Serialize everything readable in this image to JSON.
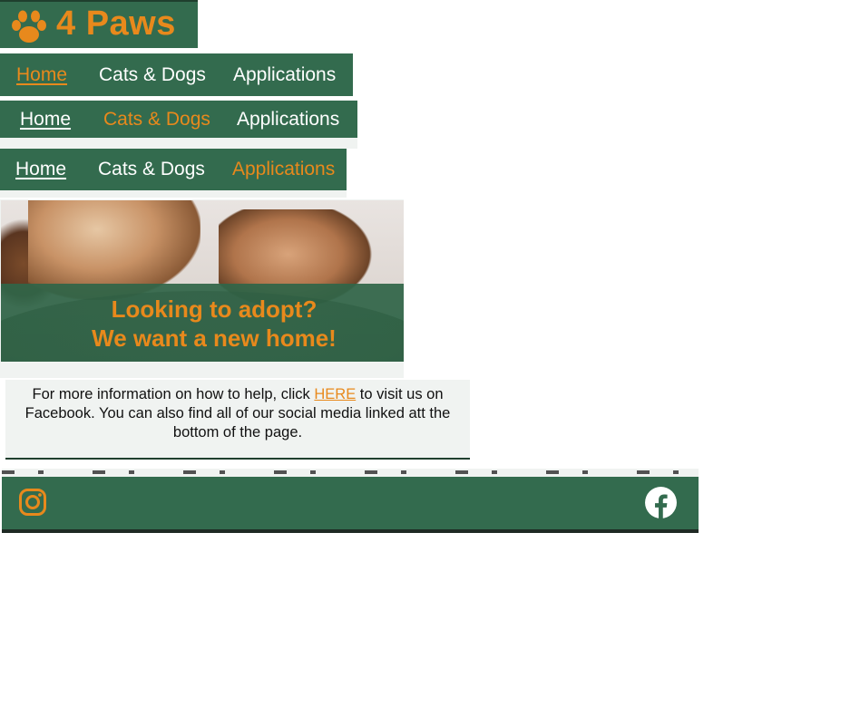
{
  "logo": {
    "text": "4 Paws",
    "icon": "paw-icon"
  },
  "navs": [
    {
      "items": [
        {
          "label": "Home",
          "active": true,
          "underline": true
        },
        {
          "label": "Cats & Dogs",
          "active": false,
          "underline": false
        },
        {
          "label": "Applications",
          "active": false,
          "underline": false
        }
      ]
    },
    {
      "items": [
        {
          "label": "Home",
          "active": false,
          "underline": true
        },
        {
          "label": "Cats & Dogs",
          "active": true,
          "underline": false
        },
        {
          "label": "Applications",
          "active": false,
          "underline": false
        }
      ]
    },
    {
      "items": [
        {
          "label": "Home",
          "active": false,
          "underline": true
        },
        {
          "label": "Cats & Dogs",
          "active": false,
          "underline": false
        },
        {
          "label": "Applications",
          "active": true,
          "underline": false
        }
      ]
    }
  ],
  "hero": {
    "line1": "Looking to adopt?",
    "line2": "We want a new home!"
  },
  "info": {
    "text_before": "For more information on how to help, click ",
    "link_text": "HERE",
    "text_after": " to visit us on Facebook. You can also find all of our social media linked att the bottom of the page."
  },
  "footer": {
    "left_icon": "instagram-icon",
    "right_icon": "facebook-icon"
  },
  "colors": {
    "green": "#336b4e",
    "orange": "#e8891c",
    "light": "#f0f3f1"
  }
}
